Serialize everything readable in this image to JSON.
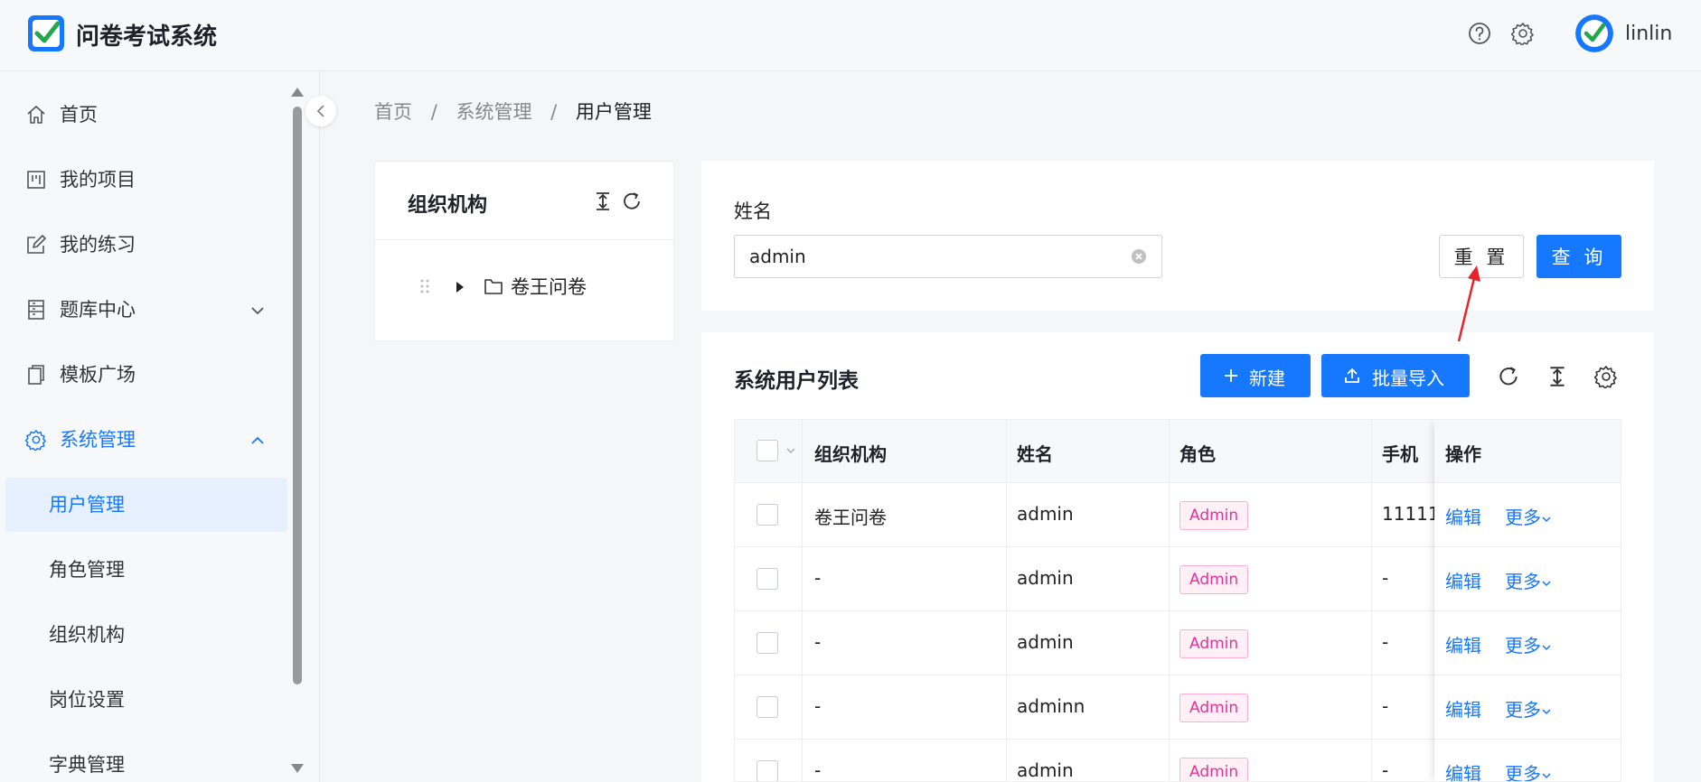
{
  "header": {
    "app_title": "问卷考试系统",
    "username": "linlin",
    "icons": [
      "help-icon",
      "gear-icon"
    ]
  },
  "sidebar": {
    "items": [
      {
        "label": "首页",
        "icon": "home-icon"
      },
      {
        "label": "我的项目",
        "icon": "project-icon"
      },
      {
        "label": "我的练习",
        "icon": "edit-icon"
      },
      {
        "label": "题库中心",
        "icon": "book-icon",
        "expandable": true
      },
      {
        "label": "模板广场",
        "icon": "template-icon"
      },
      {
        "label": "系统管理",
        "icon": "gear-icon",
        "expanded": true
      }
    ],
    "sub_items": [
      {
        "label": "用户管理",
        "selected": true
      },
      {
        "label": "角色管理"
      },
      {
        "label": "组织机构"
      },
      {
        "label": "岗位设置"
      },
      {
        "label": "字典管理"
      }
    ]
  },
  "breadcrumb": [
    "首页",
    "/",
    "系统管理",
    "/",
    "用户管理"
  ],
  "org_panel": {
    "title": "组织机构",
    "tree": [
      {
        "label": "卷王问卷"
      }
    ]
  },
  "search": {
    "label": "姓名",
    "value": "admin",
    "reset_label": "重 置",
    "query_label": "查 询"
  },
  "table_panel": {
    "title": "系统用户列表",
    "new_label": "新建",
    "import_label": "批量导入",
    "columns": [
      "组织机构",
      "姓名",
      "角色",
      "手机",
      "操作"
    ],
    "rows": [
      {
        "org": "卷王问卷",
        "name": "admin",
        "role": "Admin",
        "phone": "11111",
        "edit": "编辑",
        "more": "更多"
      },
      {
        "org": "-",
        "name": "admin",
        "role": "Admin",
        "phone": "-",
        "edit": "编辑",
        "more": "更多"
      },
      {
        "org": "-",
        "name": "admin",
        "role": "Admin",
        "phone": "-",
        "edit": "编辑",
        "more": "更多"
      },
      {
        "org": "-",
        "name": "adminn",
        "role": "Admin",
        "phone": "-",
        "edit": "编辑",
        "more": "更多"
      },
      {
        "org": "-",
        "name": "admin",
        "role": "Admin",
        "phone": "-",
        "edit": "编辑",
        "more": "更多"
      }
    ]
  },
  "colors": {
    "primary": "#1677ff",
    "tag_text": "#eb2f96",
    "tag_bg": "#fff0f6",
    "annotation": "#e8212a"
  }
}
